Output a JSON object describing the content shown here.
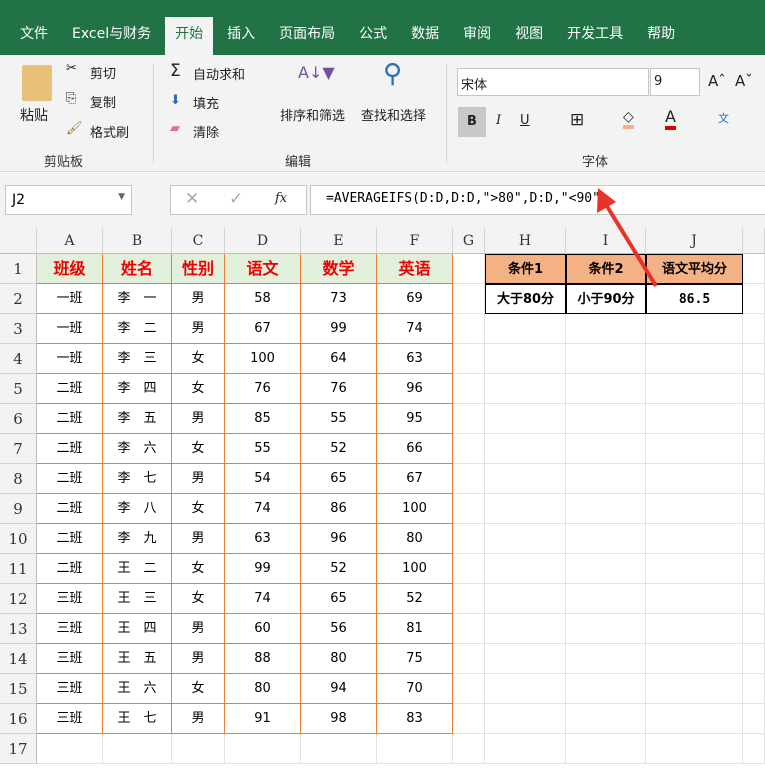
{
  "ribbon_tabs": [
    "文件",
    "Excel与财务",
    "开始",
    "插入",
    "页面布局",
    "公式",
    "数据",
    "审阅",
    "视图",
    "开发工具",
    "帮助"
  ],
  "active_tab": "开始",
  "clipboard": {
    "paste": "粘贴",
    "cut": "剪切",
    "copy": "复制",
    "format_painter": "格式刷",
    "group": "剪贴板"
  },
  "editing": {
    "autosum": "自动求和",
    "fill": "填充",
    "clear": "清除",
    "sort_filter": "排序和筛选",
    "find_select": "查找和选择",
    "group": "编辑"
  },
  "font": {
    "name": "宋体",
    "size": "9",
    "bold": "B",
    "italic": "I",
    "underline": "U",
    "group": "字体",
    "font_color": "#e00000",
    "fill_color": "#f4b183"
  },
  "formula_bar": {
    "name_box": "J2",
    "fx": "fx",
    "formula": "=AVERAGEIFS(D:D,D:D,\">80\",D:D,\"<90\")"
  },
  "columns": [
    "A",
    "B",
    "C",
    "D",
    "E",
    "F",
    "G",
    "H",
    "I",
    "J"
  ],
  "rows": [
    "1",
    "2",
    "3",
    "4",
    "5",
    "6",
    "7",
    "8",
    "9",
    "10",
    "11",
    "12",
    "13",
    "14",
    "15",
    "16",
    "17"
  ],
  "table": {
    "headers": [
      "班级",
      "姓名",
      "性别",
      "语文",
      "数学",
      "英语"
    ],
    "rows": [
      [
        "一班",
        "李　一",
        "男",
        "58",
        "73",
        "69"
      ],
      [
        "一班",
        "李　二",
        "男",
        "67",
        "99",
        "74"
      ],
      [
        "一班",
        "李　三",
        "女",
        "100",
        "64",
        "63"
      ],
      [
        "二班",
        "李　四",
        "女",
        "76",
        "76",
        "96"
      ],
      [
        "二班",
        "李　五",
        "男",
        "85",
        "55",
        "95"
      ],
      [
        "二班",
        "李　六",
        "女",
        "55",
        "52",
        "66"
      ],
      [
        "二班",
        "李　七",
        "男",
        "54",
        "65",
        "67"
      ],
      [
        "二班",
        "李　八",
        "女",
        "74",
        "86",
        "100"
      ],
      [
        "二班",
        "李　九",
        "男",
        "63",
        "96",
        "80"
      ],
      [
        "二班",
        "王　二",
        "女",
        "99",
        "52",
        "100"
      ],
      [
        "三班",
        "王　三",
        "女",
        "74",
        "65",
        "52"
      ],
      [
        "三班",
        "王　四",
        "男",
        "60",
        "56",
        "81"
      ],
      [
        "三班",
        "王　五",
        "男",
        "88",
        "80",
        "75"
      ],
      [
        "三班",
        "王　六",
        "女",
        "80",
        "94",
        "70"
      ],
      [
        "三班",
        "王　七",
        "男",
        "91",
        "98",
        "83"
      ]
    ]
  },
  "criteria": {
    "headers": [
      "条件1",
      "条件2",
      "语文平均分"
    ],
    "values": [
      "大于80分",
      "小于90分",
      "86.5"
    ]
  }
}
